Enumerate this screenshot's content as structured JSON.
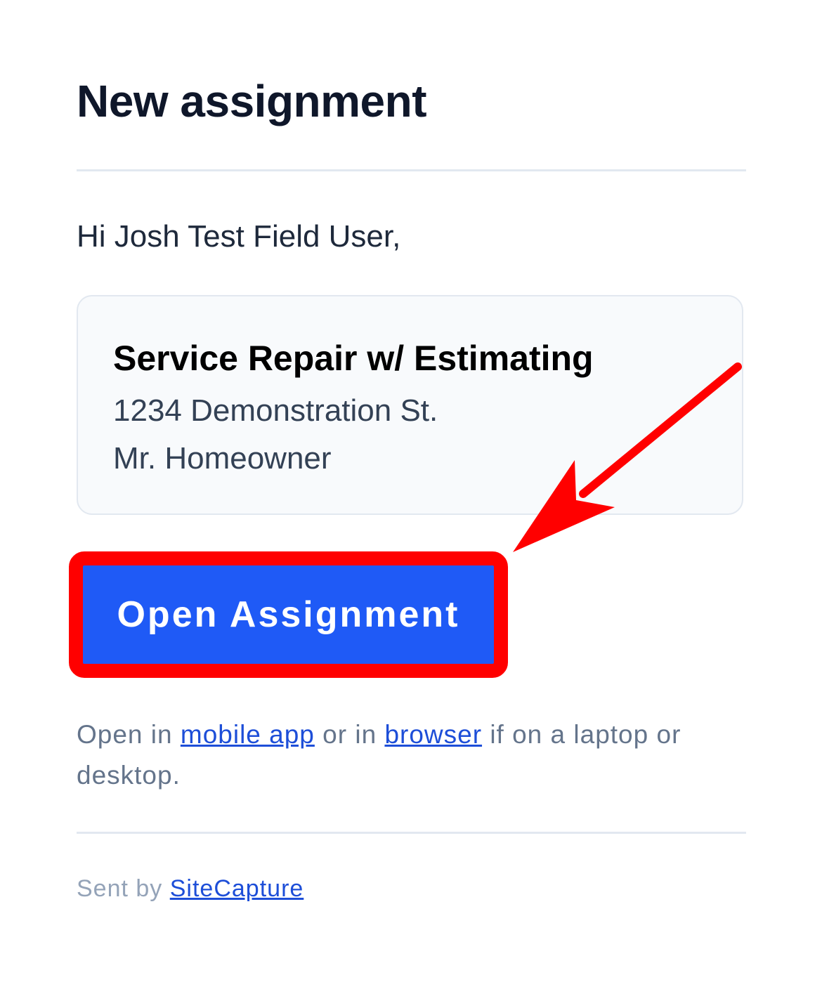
{
  "header": {
    "title": "New assignment"
  },
  "greeting": "Hi Josh Test Field User,",
  "assignment": {
    "title": "Service Repair w/ Estimating",
    "address": "1234 Demonstration St.",
    "customer": "Mr. Homeowner"
  },
  "button": {
    "label": "Open Assignment"
  },
  "note": {
    "prefix": "Open in ",
    "mobile_link": "mobile app",
    "middle": " or in ",
    "browser_link": "browser",
    "suffix": " if on a laptop or desktop."
  },
  "footer": {
    "prefix": "Sent by ",
    "link": "SiteCapture"
  },
  "colors": {
    "button_bg": "#1f5af6",
    "annotation": "#ff0000",
    "link": "#1d4ed8"
  }
}
